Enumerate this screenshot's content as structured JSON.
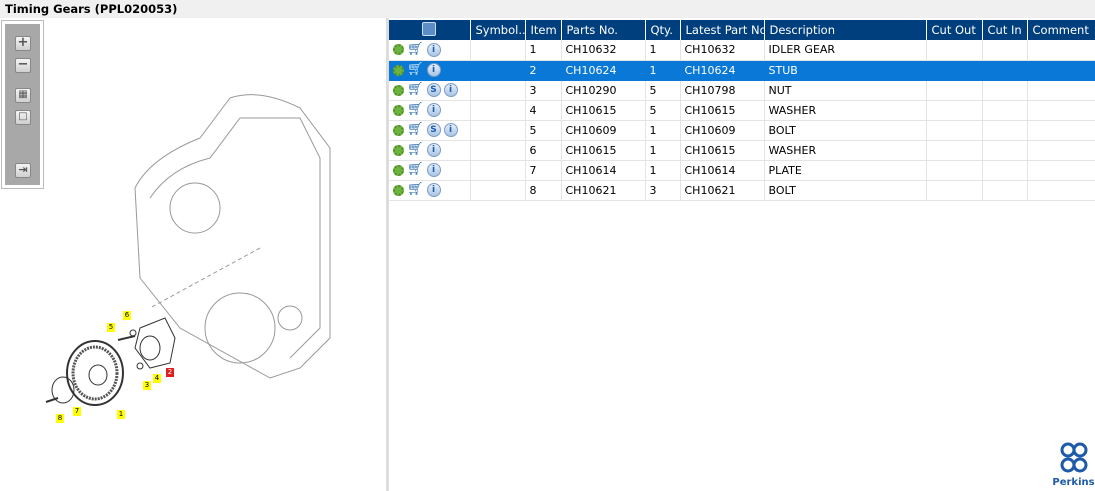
{
  "title": "Timing Gears (PPL020053)",
  "toolbar": {
    "zoom_in": "+",
    "zoom_out": "−",
    "fit": "▦",
    "reset": "□",
    "export": "⇥"
  },
  "columns": [
    "",
    "Symbol...",
    "Item",
    "Parts No.",
    "Qty.",
    "Latest Part No.",
    "Description",
    "Cut Out",
    "Cut In",
    "Comment"
  ],
  "rows": [
    {
      "icons": [
        "gear",
        "cart",
        "i"
      ],
      "symbol": "",
      "item": "1",
      "part": "CH10632",
      "qty": "1",
      "latest": "CH10632",
      "desc": "IDLER GEAR",
      "cut_out": "",
      "cut_in": "",
      "comment": ""
    },
    {
      "icons": [
        "gear",
        "cart",
        "i"
      ],
      "symbol": "",
      "item": "2",
      "part": "CH10624",
      "qty": "1",
      "latest": "CH10624",
      "desc": "STUB",
      "cut_out": "",
      "cut_in": "",
      "comment": "",
      "selected": true
    },
    {
      "icons": [
        "gear",
        "cart",
        "S",
        "i"
      ],
      "symbol": "",
      "item": "3",
      "part": "CH10290",
      "qty": "5",
      "latest": "CH10798",
      "desc": "NUT",
      "cut_out": "",
      "cut_in": "",
      "comment": ""
    },
    {
      "icons": [
        "gear",
        "cart",
        "i"
      ],
      "symbol": "",
      "item": "4",
      "part": "CH10615",
      "qty": "5",
      "latest": "CH10615",
      "desc": "WASHER",
      "cut_out": "",
      "cut_in": "",
      "comment": ""
    },
    {
      "icons": [
        "gear",
        "cart",
        "S",
        "i"
      ],
      "symbol": "",
      "item": "5",
      "part": "CH10609",
      "qty": "1",
      "latest": "CH10609",
      "desc": "BOLT",
      "cut_out": "",
      "cut_in": "",
      "comment": ""
    },
    {
      "icons": [
        "gear",
        "cart",
        "i"
      ],
      "symbol": "",
      "item": "6",
      "part": "CH10615",
      "qty": "1",
      "latest": "CH10615",
      "desc": "WASHER",
      "cut_out": "",
      "cut_in": "",
      "comment": ""
    },
    {
      "icons": [
        "gear",
        "cart",
        "i"
      ],
      "symbol": "",
      "item": "7",
      "part": "CH10614",
      "qty": "1",
      "latest": "CH10614",
      "desc": "PLATE",
      "cut_out": "",
      "cut_in": "",
      "comment": ""
    },
    {
      "icons": [
        "gear",
        "cart",
        "i"
      ],
      "symbol": "",
      "item": "8",
      "part": "CH10621",
      "qty": "3",
      "latest": "CH10621",
      "desc": "BOLT",
      "cut_out": "",
      "cut_in": "",
      "comment": ""
    }
  ],
  "callouts": [
    {
      "n": "1"
    },
    {
      "n": "2",
      "highlight": true
    },
    {
      "n": "3"
    },
    {
      "n": "4"
    },
    {
      "n": "5"
    },
    {
      "n": "6"
    },
    {
      "n": "7"
    },
    {
      "n": "8"
    }
  ],
  "logo": "Perkins",
  "colors": {
    "header": "#003f7d",
    "selected": "#0a78d7",
    "callout": "#ffff00",
    "callout_selected": "#e02020"
  }
}
